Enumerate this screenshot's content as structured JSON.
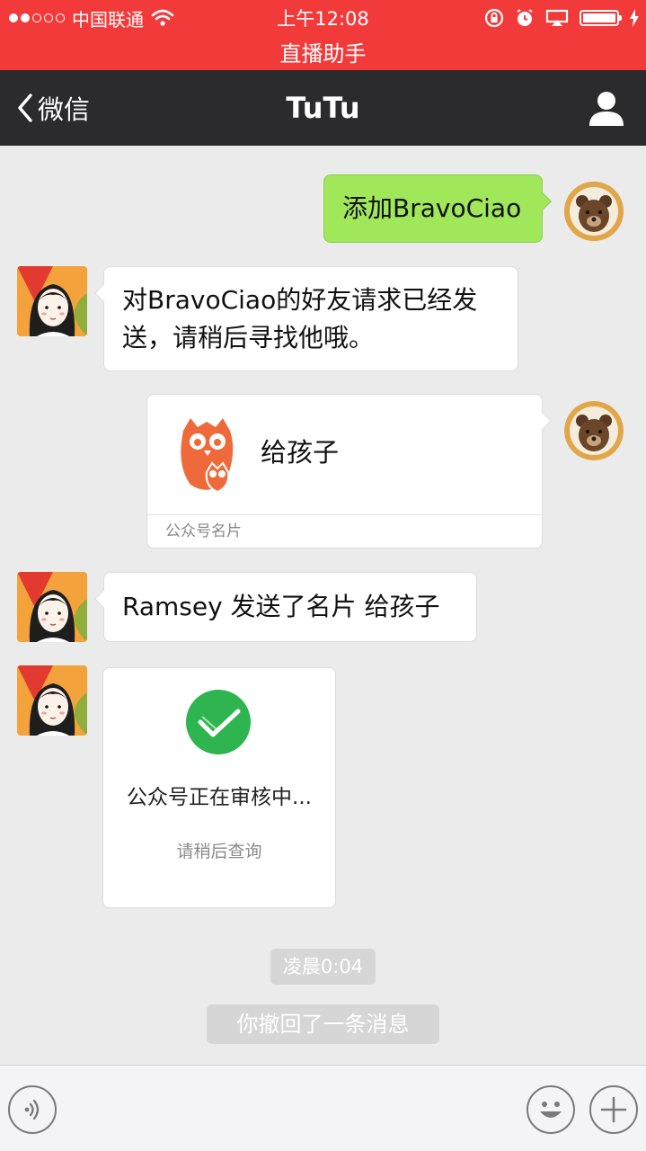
{
  "status_bar": {
    "carrier": "中国联通",
    "time": "上午12:08",
    "live_banner": "直播助手",
    "color": "#f23a3a"
  },
  "nav": {
    "back_label": "微信",
    "title": "TuTu",
    "profile_icon": "person-icon"
  },
  "messages": {
    "m1": {
      "from": "me",
      "text": "添加BravoCiao"
    },
    "m2": {
      "from": "TuTu",
      "line1": "对BravoCiao的好友请求已经发",
      "line2": "送，请稍后寻找他哦。"
    },
    "m3": {
      "from": "me",
      "type": "contact-card",
      "name": "给孩子",
      "footer": "公众号名片"
    },
    "m4": {
      "from": "TuTu",
      "text": "Ramsey 发送了名片 给孩子"
    },
    "m5": {
      "from": "TuTu",
      "type": "image",
      "title": "公众号正在审核中...",
      "subtitle": "请稍后查询"
    }
  },
  "system": {
    "timestamp": "凌晨0:04",
    "recall_notice": "你撤回了一条消息"
  },
  "input_bar": {
    "voice_icon": "voice-icon",
    "emoji_icon": "emoji-icon",
    "plus_icon": "plus-icon"
  },
  "colors": {
    "nav_bg": "#2b2b2e",
    "chat_bg": "#ebebeb",
    "sent_bubble": "#a0e75a",
    "card_logo": "#ef6a3a",
    "review_check": "#2eb54f"
  }
}
